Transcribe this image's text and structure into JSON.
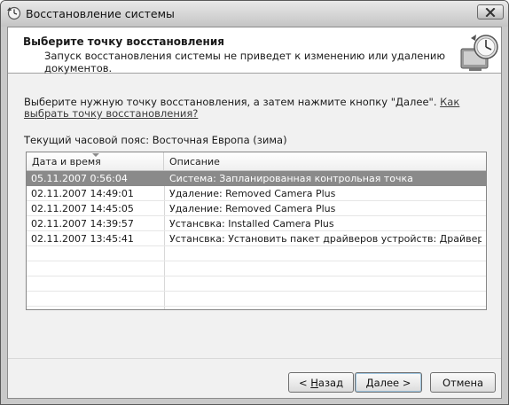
{
  "window": {
    "title": "Восстановление системы"
  },
  "header": {
    "title": "Выберите точку восстановления",
    "subtitle": "Запуск восстановления системы не приведет к изменению или удалению документов."
  },
  "body": {
    "instruction": "Выберите нужную точку восстановления, а затем нажмите кнопку \"Далее\".",
    "help_link": "Как выбрать точку восстановления?",
    "timezone": "Текущий часовой пояс: Восточная Европа (зима)"
  },
  "table": {
    "columns": [
      "Дата и время",
      "Описание"
    ],
    "sort_column": "Дата и время",
    "selected_row": 0,
    "rows": [
      {
        "date": "05.11.2007 0:56:04",
        "desc": "Система: Запланированная контрольная точка"
      },
      {
        "date": "02.11.2007 14:49:01",
        "desc": "Удаление: Removed Camera Plus"
      },
      {
        "date": "02.11.2007 14:45:05",
        "desc": "Удаление: Removed Camera Plus"
      },
      {
        "date": "02.11.2007 14:39:57",
        "desc": "Устансвка: Installed Camera Plus"
      },
      {
        "date": "02.11.2007 13:45:41",
        "desc": "Устансвка: Установить пакет драйверов устройств: ДрайверЃЕс..."
      }
    ],
    "empty_rows": 4
  },
  "buttons": {
    "back_prefix": "< ",
    "back_mnemonic": "Н",
    "back_rest": "азад",
    "next": "Далее >",
    "cancel": "Отмена"
  },
  "icons": {
    "app": "system-restore-icon",
    "close": "close-icon",
    "header": "restore-computer-clock-icon"
  },
  "colors": {
    "selection": "#8a8a8a",
    "client_bg": "#f1f1f1",
    "header_bg": "#ffffff"
  }
}
